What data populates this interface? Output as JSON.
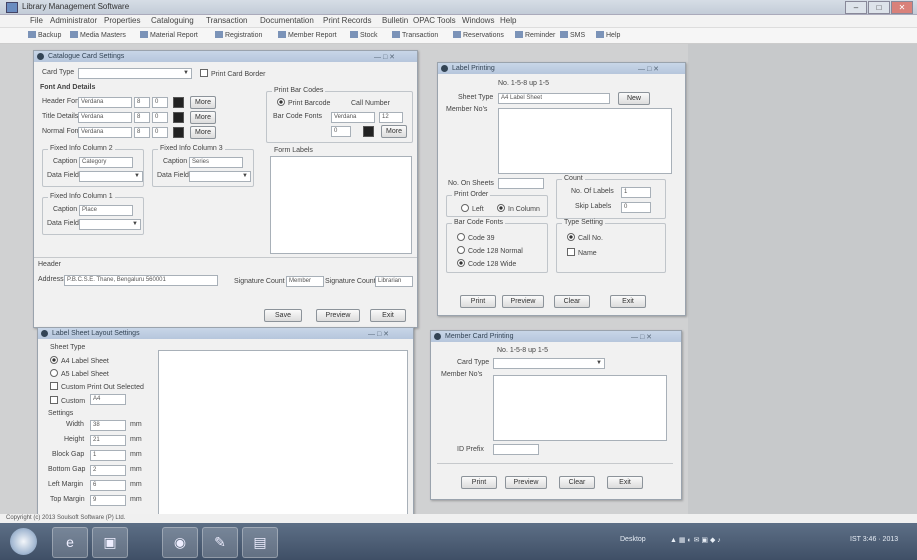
{
  "window": {
    "title": "Library Management Software",
    "min": "–",
    "max": "□",
    "close": "✕"
  },
  "menu": [
    "File",
    "Administrator",
    "Properties",
    "Cataloguing",
    "Transaction",
    "Documentation",
    "Print Records",
    "Bulletin",
    "OPAC",
    "Tools",
    "Windows",
    "Help"
  ],
  "toolbar": [
    "Backup",
    "Media Masters",
    "Material Report",
    "Registration",
    "Member Report",
    "Stock",
    "Transaction",
    "Reservations",
    "Reminder",
    "SMS",
    "Help"
  ],
  "card_print": {
    "title": "Catalogue Card Settings",
    "card_type_label": "Card Type",
    "print_border_label": "Print Card Border",
    "font_group": "Font And Details",
    "font_rows": [
      {
        "label": "Header Font",
        "font": "Verdana",
        "size": "8",
        "b": "0",
        "btn": "More"
      },
      {
        "label": "Title Details",
        "font": "Verdana",
        "size": "8",
        "b": "0",
        "btn": "More"
      },
      {
        "label": "Normal Font",
        "font": "Verdana",
        "size": "8",
        "b": "0",
        "btn": "More"
      }
    ],
    "field_group2": "Fixed Info Column 2",
    "field_group2_value": "Category",
    "field_group3": "Fixed Info Column 3",
    "field_group3_value": "Series",
    "field_group1": "Fixed Info Column 1",
    "field_group1_value": "Place",
    "caption_label": "Caption",
    "data_field_label": "Data Field",
    "barcode_group": "Print Bar Codes",
    "barcode_opt1": "Print Barcode",
    "barcode_opt2": "Call Number",
    "barcode_font_label": "Bar Code Fonts",
    "barcode_font": "Verdana",
    "barcode_size": "12",
    "barcode_b": "0",
    "barcode_btn": "More",
    "form_label": "Form Labels",
    "footer_group": "Header",
    "address_label": "Address",
    "address_value": "P.B.C.S.E. Thane, Bengaluru 560001",
    "apprv1_label": "Signature Count",
    "apprv1_value": "Member",
    "apprv2_label": "Signature Count",
    "apprv2_value": "Librarian",
    "save": "Save",
    "preview": "Preview",
    "exit": "Exit"
  },
  "label_print": {
    "title": "Label Printing",
    "stock_label": "No. 1-5-8 up 1-5",
    "sheet_type_label": "Sheet Type",
    "sheet_type": "A4 Label Sheet",
    "sheet_btn": "New",
    "member_label": "Member No's",
    "no_labels_label": "No. On Sheets",
    "order_group": "Print Order",
    "order_opt1": "Left",
    "order_opt2": "In Column",
    "count_group": "Count",
    "count_rows": [
      {
        "label": "No. Of Labels",
        "value": "1"
      },
      {
        "label": "Skip Labels",
        "value": "0"
      }
    ],
    "barcode_group": "Bar Code Fonts",
    "barcode_opts": [
      "Code 39",
      "Code 128 Normal",
      "Code 128 Wide"
    ],
    "type_group": "Type Setting",
    "type_opts": [
      "Call No.",
      "Name"
    ],
    "print": "Print",
    "preview": "Preview",
    "clear": "Clear",
    "exit": "Exit"
  },
  "layout": {
    "title": "Label Sheet Layout Settings",
    "sheet_type_label": "Sheet Type",
    "sheet_opts": [
      "A4 Label Sheet",
      "A5 Label Sheet",
      "Custom Print Out Selected"
    ],
    "custom_label": "Custom",
    "custom_value": "A4",
    "settings_label": "Settings",
    "rows": [
      {
        "label": "Width",
        "value": "38",
        "unit": "mm"
      },
      {
        "label": "Height",
        "value": "21",
        "unit": "mm"
      },
      {
        "label": "Block Gap",
        "value": "1",
        "unit": "mm"
      },
      {
        "label": "Bottom Gap",
        "value": "2",
        "unit": "mm"
      },
      {
        "label": "Left Margin",
        "value": "6",
        "unit": "mm"
      },
      {
        "label": "Top Margin",
        "value": "9",
        "unit": "mm"
      }
    ]
  },
  "member_print": {
    "title": "Member Card Printing",
    "stock_label": "No. 1-5-8 up 1-5",
    "card_type_label": "Card Type",
    "member_label": "Member No's",
    "id_label": "ID Prefix",
    "print": "Print",
    "preview": "Preview",
    "clear": "Clear",
    "exit": "Exit"
  },
  "status": "Copyright (c) 2013 Soulsoft Software (P) Ltd.",
  "taskbar": {
    "apps": [
      "e",
      "▣",
      "◉",
      "✎",
      "▤"
    ],
    "desktop_label": "Desktop",
    "clock": "IST 3:46 · 2013"
  }
}
